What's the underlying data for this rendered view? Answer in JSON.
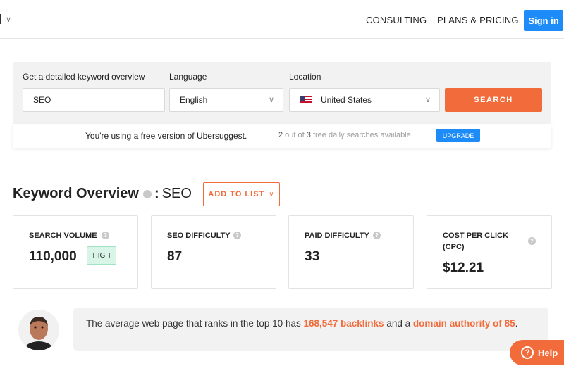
{
  "nav": {
    "lang_chevron": "∨",
    "links": [
      "CONSULTING",
      "PLANS & PRICING"
    ],
    "signin": "Sign in"
  },
  "search": {
    "keyword_label": "Get a detailed keyword overview",
    "keyword_value": "SEO",
    "language_label": "Language",
    "language_value": "English",
    "location_label": "Location",
    "location_value": "United States",
    "button": "SEARCH"
  },
  "free": {
    "message": "You're using a free version of Ubersuggest.",
    "used": "2",
    "mid": " out of ",
    "total": "3",
    "suffix": " free daily searches available",
    "upgrade": "UPGRADE"
  },
  "overview": {
    "title": "Keyword Overview",
    "keyword": "SEO",
    "add_to_list": "ADD TO LIST"
  },
  "metrics": [
    {
      "label": "SEARCH VOLUME",
      "value": "110,000",
      "badge": "HIGH"
    },
    {
      "label": "SEO DIFFICULTY",
      "value": "87"
    },
    {
      "label": "PAID DIFFICULTY",
      "value": "33"
    },
    {
      "label": "COST PER CLICK (CPC)",
      "value": "$12.21"
    }
  ],
  "tip": {
    "prefix": "The average web page that ranks in the top 10 has ",
    "backlinks": "168,547 backlinks",
    "middle": " and a ",
    "authority": "domain authority of 85",
    "suffix": "."
  },
  "help": "Help",
  "colors": {
    "accent": "#f26b3a",
    "primary_blue": "#1d8cf8",
    "high_badge_bg": "#d8f5e8"
  }
}
